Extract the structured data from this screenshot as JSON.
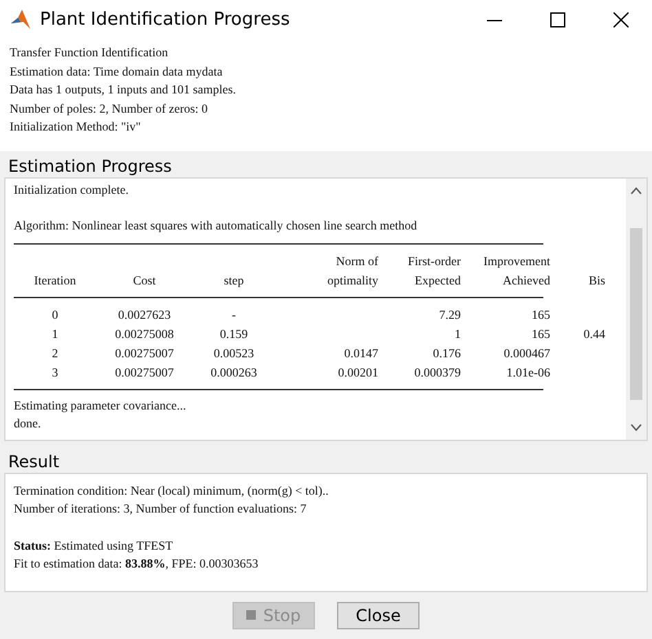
{
  "window": {
    "title": "Plant Identification Progress"
  },
  "header_lines": [
    "Transfer Function Identification",
    "Estimation data: Time domain data mydata",
    "Data has 1 outputs, 1 inputs and 101 samples.",
    "Number of poles: 2, Number of zeros: 0",
    "Initialization Method: \"iv\""
  ],
  "progress": {
    "title": "Estimation Progress",
    "intro_lines": [
      "Initialization complete.",
      "Algorithm: Nonlinear least squares with automatically chosen line search method"
    ],
    "table": {
      "header_top": {
        "column_4": "Norm of",
        "column_5": "First-order",
        "column_6": "Improvement"
      },
      "header_bottom": {
        "iteration": "Iteration",
        "cost": "Cost",
        "step": "step",
        "column_4": "optimality",
        "column_5": "Expected",
        "column_6": "Achieved",
        "column_7": "Bis"
      },
      "rows": [
        {
          "iteration": "0",
          "cost": "0.0027623",
          "step": "-",
          "column_5": "7.29",
          "column_6": "165"
        },
        {
          "iteration": "1",
          "cost": "0.00275008",
          "step": "0.159",
          "column_5": "1",
          "column_6": "165",
          "column_7": "0.44"
        },
        {
          "iteration": "2",
          "cost": "0.00275007",
          "step": "0.00523",
          "column_4": "0.0147",
          "column_5": "0.176",
          "column_6": "0.000467"
        },
        {
          "iteration": "3",
          "cost": "0.00275007",
          "step": "0.000263",
          "column_4": "0.00201",
          "column_5": "0.000379",
          "column_6": "1.01e-06"
        }
      ]
    },
    "outro_lines": [
      "Estimating parameter covariance...",
      "done."
    ]
  },
  "result": {
    "title": "Result",
    "lines": [
      "Termination condition: Near (local) minimum, (norm(g) < tol)..",
      "Number of iterations: 3, Number of function evaluations: 7"
    ],
    "status": "**Status:** Estimated using TFEST",
    "fit": "Fit to estimation data: **83.88%**, FPE: 0.00303653"
  },
  "buttons": [
    {
      "label": "Stop",
      "kind": "stop",
      "disabled": true
    },
    {
      "label": "Close",
      "kind": "plain",
      "disabled": false
    }
  ]
}
